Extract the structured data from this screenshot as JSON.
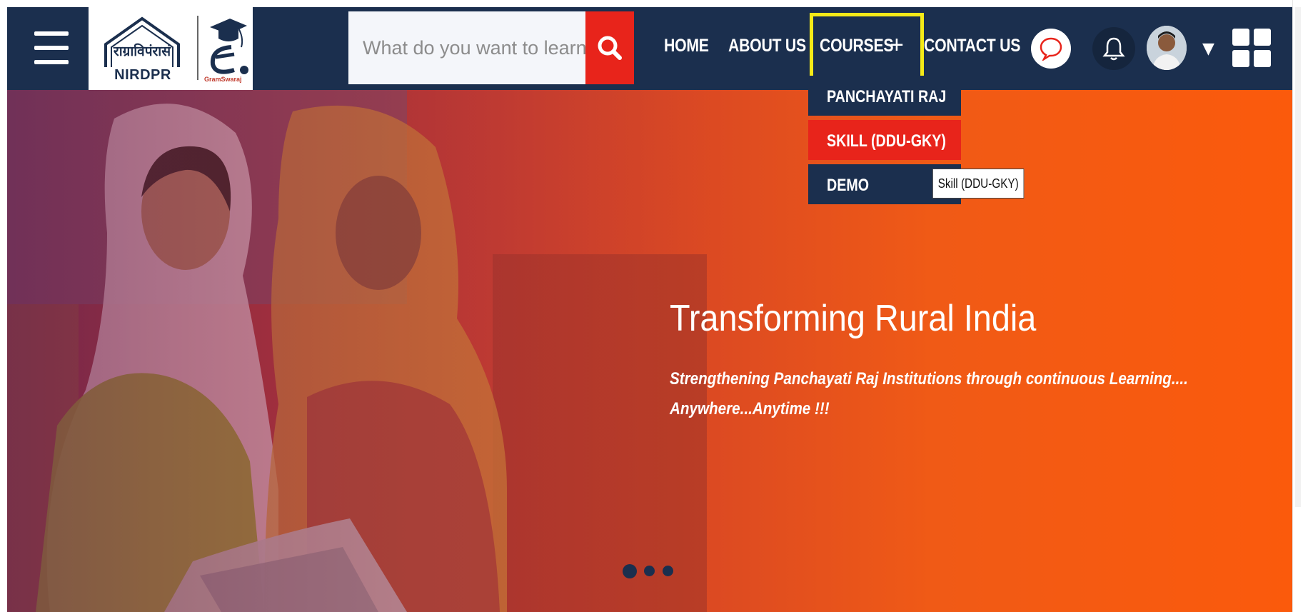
{
  "header": {
    "logo_text": "NIRDPR",
    "logo_hindi": "राग्राविपंरासं",
    "logo_egs_label": "GramSwaraj",
    "search_placeholder": "What do you want to learn?",
    "nav": [
      "HOME",
      "ABOUT US",
      "COURSES",
      "CONTACT US"
    ],
    "courses_plus": "+",
    "user_caret": "▼"
  },
  "dropdown": {
    "items": [
      "PANCHAYATI RAJ",
      "SKILL (DDU-GKY)",
      "DEMO"
    ],
    "active_index": 1,
    "tooltip": "Skill (DDU-GKY)"
  },
  "hero": {
    "title": "Transforming Rural India",
    "subtitle_line1": "Strengthening Panchayati Raj Institutions through continuous Learning....",
    "subtitle_line2": "Anywhere...Anytime !!!",
    "slide_count": 3,
    "active_slide": 1
  },
  "colors": {
    "header_bg": "#1b2f4e",
    "accent_red": "#e8241b",
    "highlight_yellow": "#f5ea17",
    "hero_orange": "#fb5a0c"
  }
}
